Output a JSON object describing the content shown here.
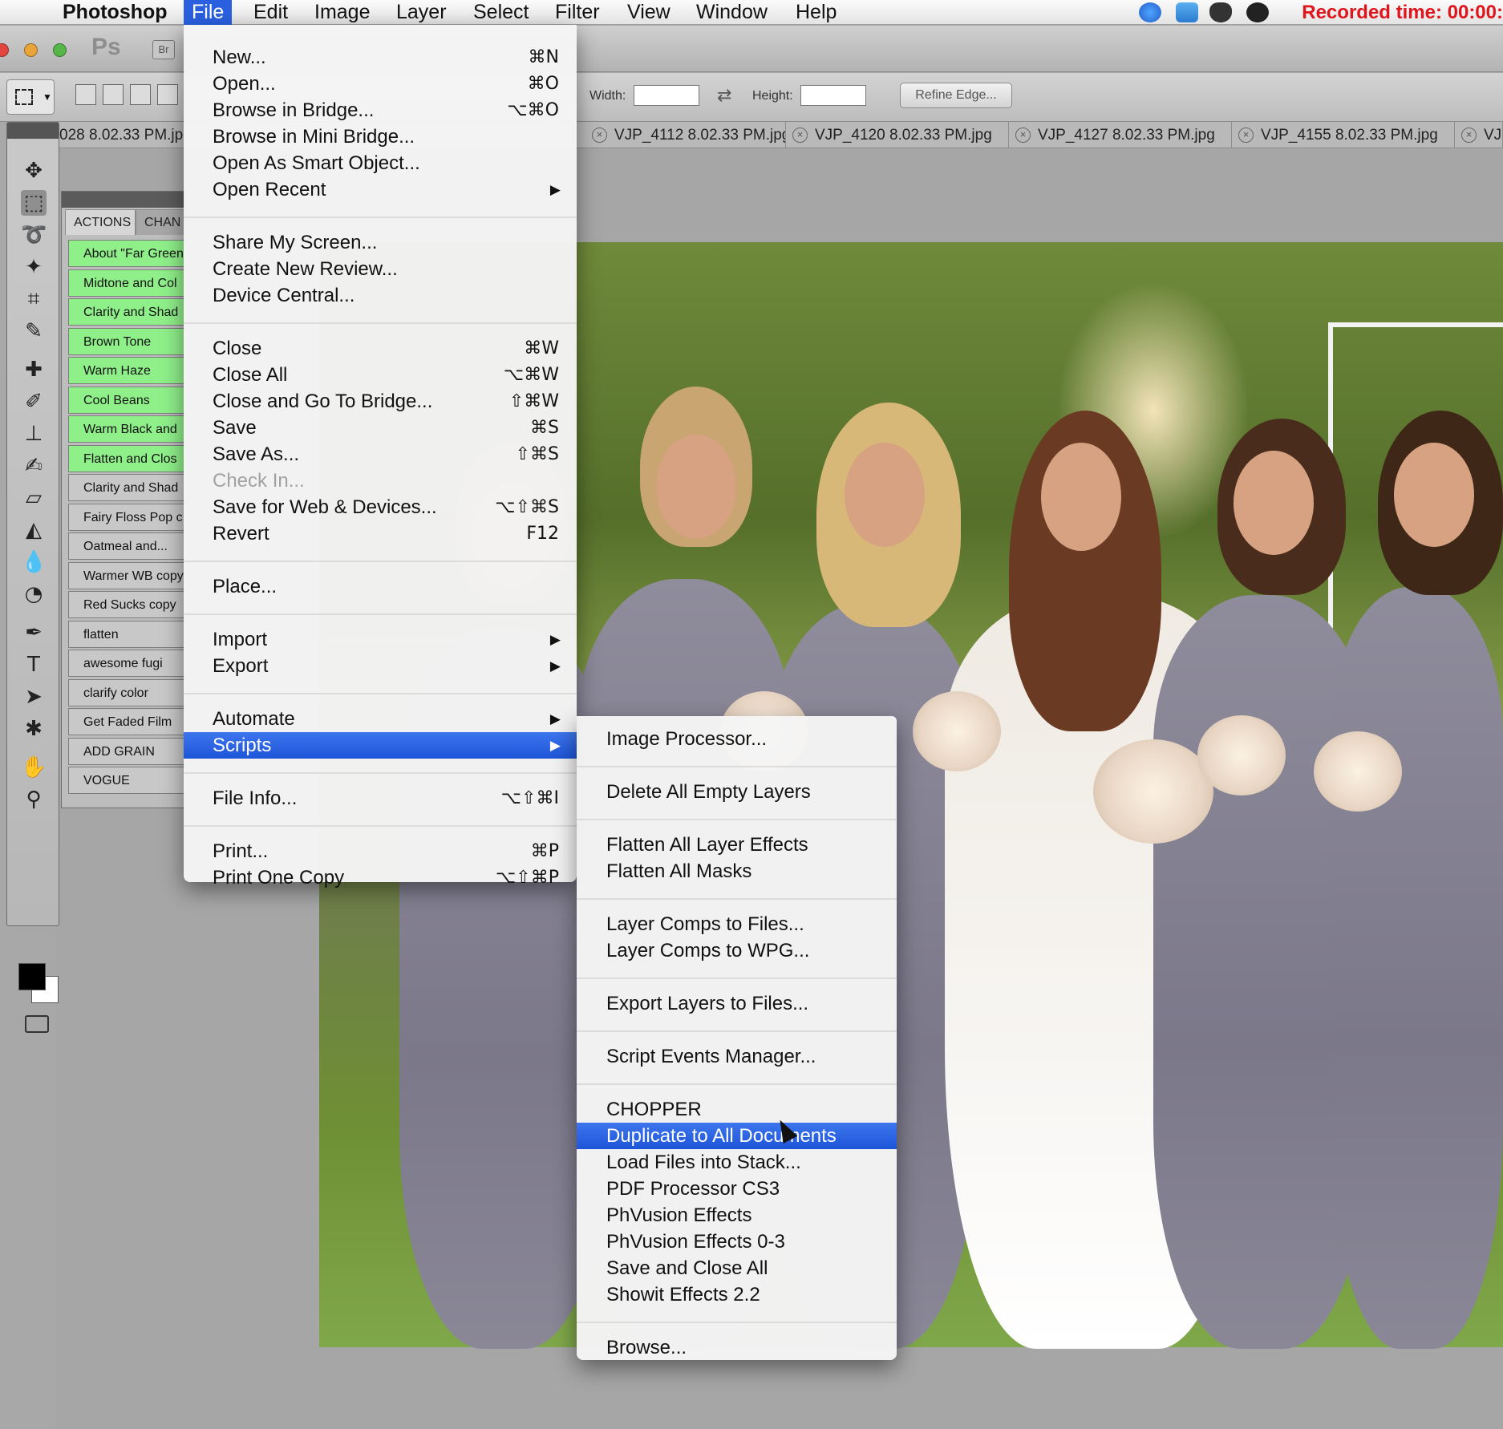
{
  "menubar": {
    "app_name": "Photoshop",
    "menus": [
      "File",
      "Edit",
      "Image",
      "Layer",
      "Select",
      "Filter",
      "View",
      "Window",
      "Help"
    ],
    "active_menu": "File",
    "recorded_time": "Recorded time: 00:00:"
  },
  "appbar": {
    "ps_logo": "Ps",
    "bridge_button": "Br"
  },
  "options_bar": {
    "width_label": "Width:",
    "height_label": "Height:",
    "refine_edge_label": "Refine Edge..."
  },
  "document_tabs": [
    "028 8.02.33 PM.jp",
    "VJP_4112 8.02.33 PM.jpg",
    "VJP_4120 8.02.33 PM.jpg",
    "VJP_4127 8.02.33 PM.jpg",
    "VJP_4155 8.02.33 PM.jpg",
    "VJP"
  ],
  "actions_panel": {
    "tabs": [
      "ACTIONS",
      "CHAN"
    ],
    "items": [
      {
        "label": "About \"Far Green",
        "color": "green"
      },
      {
        "label": "Midtone and Col",
        "color": "green"
      },
      {
        "label": "Clarity and Shad",
        "color": "green"
      },
      {
        "label": "Brown Tone",
        "color": "green"
      },
      {
        "label": "Warm Haze",
        "color": "green"
      },
      {
        "label": "Cool Beans",
        "color": "green"
      },
      {
        "label": "Warm Black and",
        "color": "green"
      },
      {
        "label": "Flatten and Clos",
        "color": "green"
      },
      {
        "label": "Clarity and Shad",
        "color": "gray"
      },
      {
        "label": "Fairy Floss Pop c",
        "color": "gray"
      },
      {
        "label": "Oatmeal and...",
        "color": "gray"
      },
      {
        "label": "Warmer WB copy",
        "color": "gray"
      },
      {
        "label": "Red Sucks copy",
        "color": "gray"
      },
      {
        "label": "flatten",
        "color": "gray"
      },
      {
        "label": "awesome fugi",
        "color": "gray"
      },
      {
        "label": "clarify color",
        "color": "gray"
      },
      {
        "label": "Get Faded Film",
        "color": "gray"
      },
      {
        "label": "ADD GRAIN",
        "color": "gray"
      },
      {
        "label": "VOGUE",
        "color": "gray"
      }
    ]
  },
  "file_menu": {
    "items": [
      {
        "label": "New...",
        "shortcut": "⌘N"
      },
      {
        "label": "Open...",
        "shortcut": "⌘O"
      },
      {
        "label": "Browse in Bridge...",
        "shortcut": "⌥⌘O"
      },
      {
        "label": "Browse in Mini Bridge...",
        "shortcut": ""
      },
      {
        "label": "Open As Smart Object...",
        "shortcut": ""
      },
      {
        "label": "Open Recent",
        "shortcut": "",
        "submenu": true
      },
      {
        "label": "Share My Screen...",
        "shortcut": ""
      },
      {
        "label": "Create New Review...",
        "shortcut": ""
      },
      {
        "label": "Device Central...",
        "shortcut": ""
      },
      {
        "label": "Close",
        "shortcut": "⌘W"
      },
      {
        "label": "Close All",
        "shortcut": "⌥⌘W"
      },
      {
        "label": "Close and Go To Bridge...",
        "shortcut": "⇧⌘W"
      },
      {
        "label": "Save",
        "shortcut": "⌘S"
      },
      {
        "label": "Save As...",
        "shortcut": "⇧⌘S"
      },
      {
        "label": "Check In...",
        "shortcut": "",
        "disabled": true
      },
      {
        "label": "Save for Web & Devices...",
        "shortcut": "⌥⇧⌘S"
      },
      {
        "label": "Revert",
        "shortcut": "F12"
      },
      {
        "label": "Place...",
        "shortcut": ""
      },
      {
        "label": "Import",
        "shortcut": "",
        "submenu": true
      },
      {
        "label": "Export",
        "shortcut": "",
        "submenu": true
      },
      {
        "label": "Automate",
        "shortcut": "",
        "submenu": true
      },
      {
        "label": "Scripts",
        "shortcut": "",
        "submenu": true,
        "highlighted": true
      },
      {
        "label": "File Info...",
        "shortcut": "⌥⇧⌘I"
      },
      {
        "label": "Print...",
        "shortcut": "⌘P"
      },
      {
        "label": "Print One Copy",
        "shortcut": "⌥⇧⌘P"
      }
    ]
  },
  "scripts_menu": {
    "items": [
      "Image Processor...",
      "Delete All Empty Layers",
      "Flatten All Layer Effects",
      "Flatten All Masks",
      "Layer Comps to Files...",
      "Layer Comps to WPG...",
      "Export Layers to Files...",
      "Script Events Manager...",
      "CHOPPER",
      "Duplicate to All Documents",
      "Load Files into Stack...",
      "PDF Processor CS3",
      "PhVusion Effects",
      "PhVusion Effects 0-3",
      "Save and Close All",
      "Showit Effects 2.2",
      "Browse..."
    ],
    "highlighted": "Duplicate to All Documents"
  },
  "colors": {
    "menu_highlight": "#2a60e0",
    "recorded_text": "#e0141b",
    "action_green": "#8ff08a"
  }
}
